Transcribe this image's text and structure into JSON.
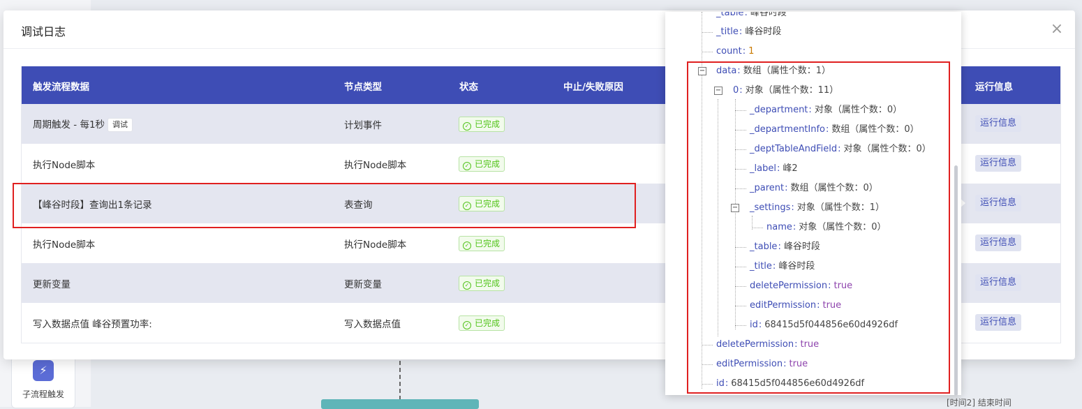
{
  "background": {
    "subflow_label": "子流程触发",
    "subflow_icon": "lightning-icon",
    "bottom_right_text": "[时间2] 结束时间"
  },
  "modal": {
    "title": "调试日志",
    "close_icon": "close-icon",
    "columns": [
      "触发流程数据",
      "节点类型",
      "状态",
      "中止/失败原因",
      "运行信息"
    ],
    "rows": [
      {
        "trigger": "周期触发 - 每1秒",
        "tag": "调试",
        "type": "计划事件",
        "status": "已完成",
        "action": "运行信息"
      },
      {
        "trigger": "执行Node脚本",
        "type": "执行Node脚本",
        "status": "已完成",
        "action": "运行信息"
      },
      {
        "trigger": "【峰谷时段】查询出1条记录",
        "type": "表查询",
        "status": "已完成",
        "action": "运行信息"
      },
      {
        "trigger": "执行Node脚本",
        "type": "执行Node脚本",
        "status": "已完成",
        "action": "运行信息"
      },
      {
        "trigger": "更新变量",
        "type": "更新变量",
        "status": "已完成",
        "action": "运行信息"
      },
      {
        "trigger": "写入数据点值 峰谷预置功率:",
        "type": "写入数据点值",
        "status": "已完成",
        "action": "运行信息"
      }
    ]
  },
  "tree": {
    "nodes": [
      {
        "key": "_table",
        "value": "峰谷时段",
        "kind": "str"
      },
      {
        "key": "_title",
        "value": "峰谷时段",
        "kind": "str"
      },
      {
        "key": "count",
        "value": "1",
        "kind": "num"
      },
      {
        "key": "data",
        "value": "数组（属性个数：1）",
        "kind": "str"
      },
      {
        "key": "0",
        "value": "对象（属性个数：11）",
        "kind": "str"
      },
      {
        "key": "_department",
        "value": "对象（属性个数：0）",
        "kind": "str"
      },
      {
        "key": "_departmentInfo",
        "value": "数组（属性个数：0）",
        "kind": "str"
      },
      {
        "key": "_deptTableAndField",
        "value": "对象（属性个数：0）",
        "kind": "str"
      },
      {
        "key": "_label",
        "value": "峰2",
        "kind": "str"
      },
      {
        "key": "_parent",
        "value": "数组（属性个数：0）",
        "kind": "str"
      },
      {
        "key": "_settings",
        "value": "对象（属性个数：1）",
        "kind": "str"
      },
      {
        "key": "name",
        "value": "对象（属性个数：0）",
        "kind": "str"
      },
      {
        "key": "_table",
        "value": "峰谷时段",
        "kind": "str"
      },
      {
        "key": "_title",
        "value": "峰谷时段",
        "kind": "str"
      },
      {
        "key": "deletePermission",
        "value": "true",
        "kind": "bool"
      },
      {
        "key": "editPermission",
        "value": "true",
        "kind": "bool"
      },
      {
        "key": "id",
        "value": "68415d5f044856e60d4926df",
        "kind": "str"
      },
      {
        "key": "deletePermission",
        "value": "true",
        "kind": "bool"
      },
      {
        "key": "editPermission",
        "value": "true",
        "kind": "bool"
      },
      {
        "key": "id",
        "value": "68415d5f044856e60d4926df",
        "kind": "str"
      }
    ],
    "toggle_symbol": "−"
  },
  "colors": {
    "header": "#3e4db5",
    "highlight": "#e02020",
    "success": "#52c41a"
  }
}
